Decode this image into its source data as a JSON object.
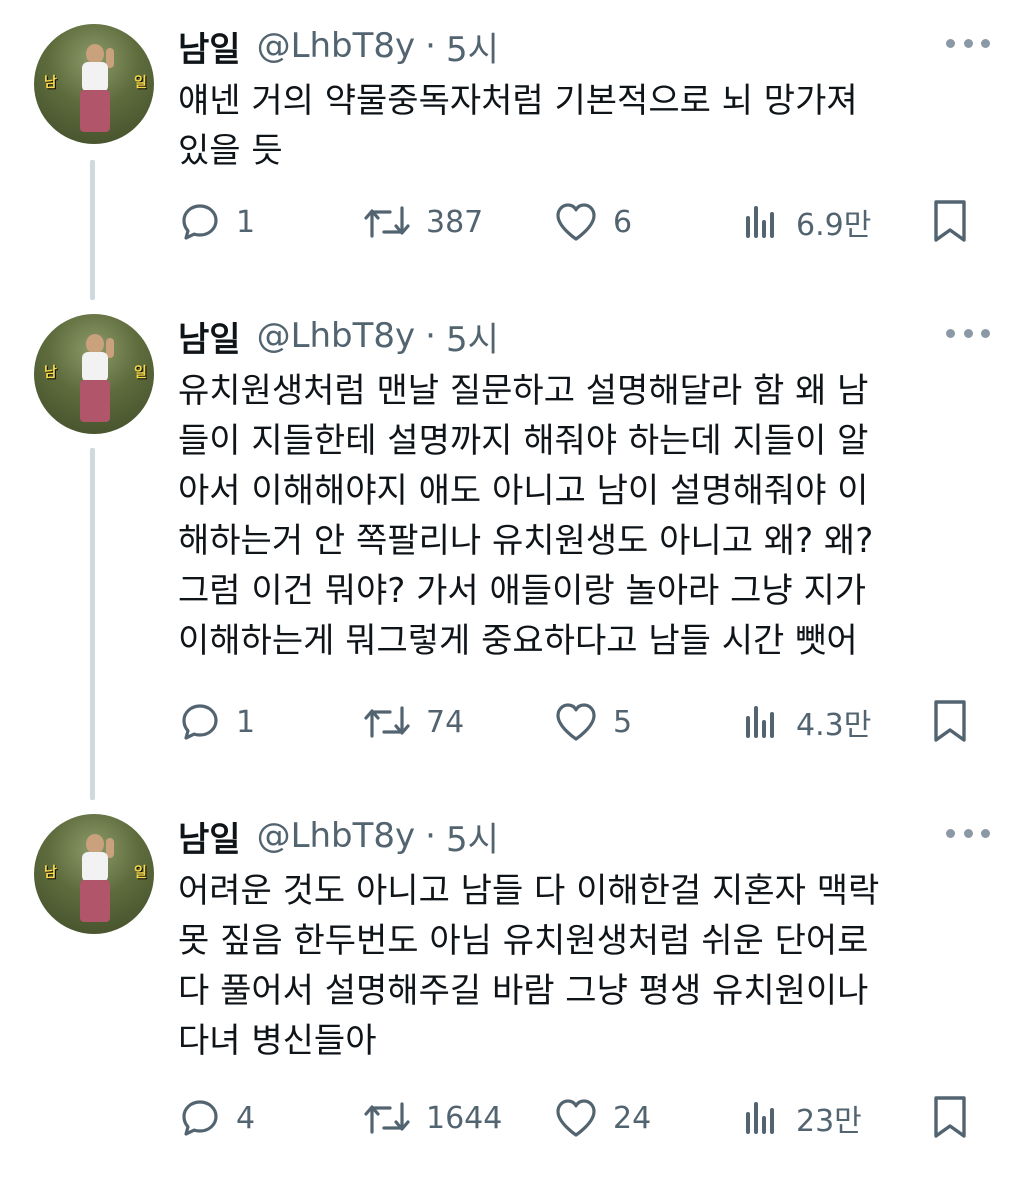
{
  "tweets": [
    {
      "name": "남일",
      "handle": "@LhbT8y",
      "separator": "·",
      "time": "5시",
      "text": "얘넨 거의 약물중독자처럼 기본적으로 뇌 망가져\n있을 듯",
      "avatar_caption_left": "남",
      "avatar_caption_right": "일",
      "replies": "1",
      "retweets": "387",
      "likes": "6",
      "views": "6.9만"
    },
    {
      "name": "남일",
      "handle": "@LhbT8y",
      "separator": "·",
      "time": "5시",
      "text": "유치원생처럼 맨날 질문하고 설명해달라 함 왜 남\n들이 지들한테 설명까지 해줘야 하는데 지들이 알\n아서 이해해야지 애도 아니고 남이 설명해줘야 이\n해하는거 안 쪽팔리나 유치원생도 아니고 왜? 왜?\n그럼 이건 뭐야? 가서 애들이랑 놀아라 그냥 지가\n이해하는게 뭐그렇게 중요하다고 남들 시간 뺏어",
      "avatar_caption_left": "남",
      "avatar_caption_right": "일",
      "replies": "1",
      "retweets": "74",
      "likes": "5",
      "views": "4.3만"
    },
    {
      "name": "남일",
      "handle": "@LhbT8y",
      "separator": "·",
      "time": "5시",
      "text": "어려운 것도 아니고 남들 다 이해한걸 지혼자 맥락\n못 짚음 한두번도 아님 유치원생처럼 쉬운 단어로\n다 풀어서 설명해주길 바람 그냥 평생 유치원이나\n다녀 병신들아",
      "avatar_caption_left": "남",
      "avatar_caption_right": "일",
      "replies": "4",
      "retweets": "1644",
      "likes": "24",
      "views": "23만"
    }
  ],
  "icons": {
    "reply": "reply-icon",
    "retweet": "retweet-icon",
    "like": "heart-icon",
    "views": "views-chart-icon",
    "bookmark": "bookmark-icon",
    "more": "more-dots-icon"
  },
  "colors": {
    "text": "#0f1419",
    "secondary": "#536471",
    "thread_line": "#cfd9de"
  }
}
